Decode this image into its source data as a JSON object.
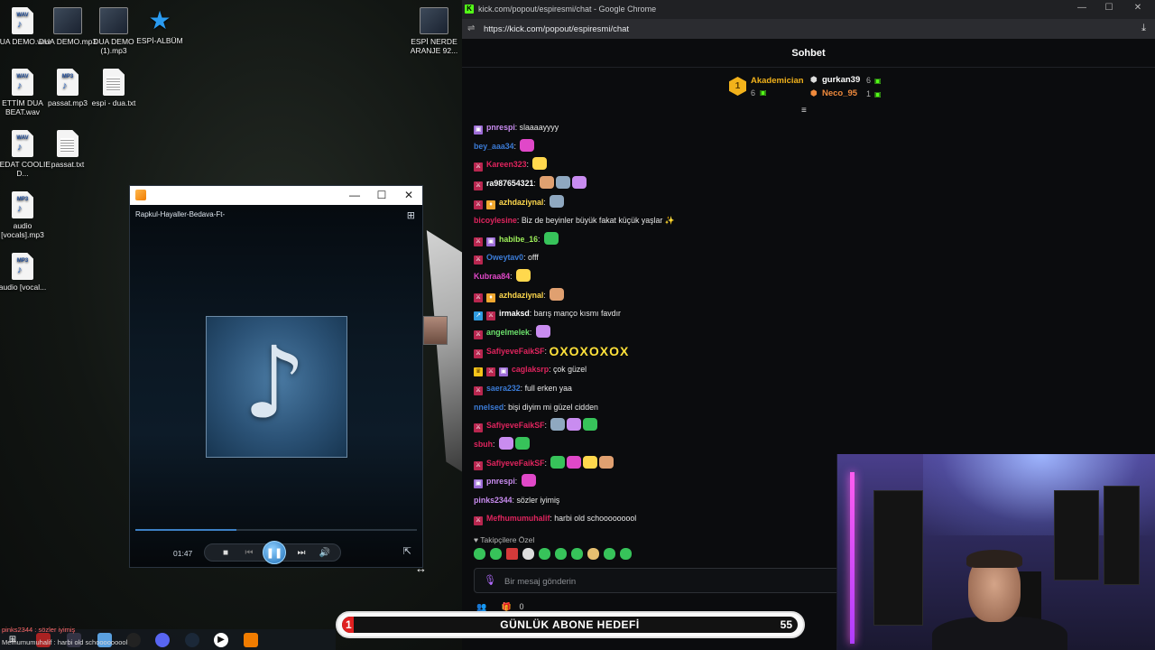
{
  "desktop": {
    "icons": [
      {
        "label": "DUA DEMO.wav",
        "tag": "WAV"
      },
      {
        "label": "DUA DEMO.mp3",
        "tag": ""
      },
      {
        "label": "DUA DEMO (1).mp3",
        "tag": ""
      },
      {
        "label": "ESPİ-ALBÜM",
        "tag": ""
      },
      {
        "label": "ESPİ NERDE ARANJE 92...",
        "tag": ""
      },
      {
        "label": "ETTİM DUA BEAT.wav",
        "tag": "WAV"
      },
      {
        "label": "passat.mp3",
        "tag": "MP3"
      },
      {
        "label": "espi - dua.txt",
        "tag": ""
      },
      {
        "label": "SEDAT COOLIE D...",
        "tag": "WAV"
      },
      {
        "label": "passat.txt",
        "tag": ""
      },
      {
        "label": "audio [vocals].mp3",
        "tag": "MP3"
      },
      {
        "label": "audio [vocal...",
        "tag": "MP3"
      }
    ]
  },
  "player": {
    "track_title": "Rapkul-Hayaller-Bedava-Ft-",
    "current_time": "01:47",
    "progress": 0.36,
    "icons": {
      "app": "media-player-icon",
      "minimize": "minimize-icon",
      "maximize": "maximize-icon",
      "close": "close-icon",
      "miniplayer": "miniplayer-icon",
      "stop": "stop-icon",
      "previous": "previous-icon",
      "pause": "pause-icon",
      "next": "next-icon",
      "volume": "volume-icon",
      "fullscreen": "fullscreen-icon"
    }
  },
  "browser": {
    "window_title": "kick.com/popout/espiresmi/chat - Google Chrome",
    "url": "https://kick.com/popout/espiresmi/chat"
  },
  "chat": {
    "title": "Sohbet",
    "leaderboard": [
      {
        "name": "Akademician",
        "count": "6",
        "rank": "1",
        "color": "#f2b21b"
      },
      {
        "name": "gurkan39",
        "count": "6",
        "color": "#ffffff"
      },
      {
        "name": "Neco_95",
        "count": "1",
        "color": "#f08a3c"
      }
    ],
    "messages": [
      {
        "user": "pnrespi",
        "color": "#c98cf0",
        "badges": [
          "gift"
        ],
        "text": "slaaaayyyy",
        "emotes": 0
      },
      {
        "user": "bey_aaa34",
        "color": "#3b7bd6",
        "badges": [],
        "text": "",
        "emotes": 1
      },
      {
        "user": "Kareen323",
        "color": "#e0245e",
        "badges": [
          "mod"
        ],
        "text": "",
        "emotes": 1
      },
      {
        "user": "ra987654321",
        "color": "#ffffff",
        "badges": [
          "mod"
        ],
        "text": "",
        "emotes": 3
      },
      {
        "user": "azhdaziynal",
        "color": "#ffd84d",
        "badges": [
          "mod",
          "sub"
        ],
        "text": "",
        "emotes": 1
      },
      {
        "user": "bicoylesine",
        "color": "#e0245e",
        "badges": [],
        "text": "Biz de beyinler büyük fakat küçük yaşlar ✨",
        "emotes": 0
      },
      {
        "user": "habibe_16",
        "color": "#9ef05a",
        "badges": [
          "mod",
          "gift"
        ],
        "text": "",
        "emotes": 1
      },
      {
        "user": "Oweytav0",
        "color": "#3b7bd6",
        "badges": [
          "mod"
        ],
        "text": "offf",
        "emotes": 0
      },
      {
        "user": "Kubraa84",
        "color": "#e048c8",
        "badges": [],
        "text": "",
        "emotes": 1
      },
      {
        "user": "azhdaziynal",
        "color": "#ffd84d",
        "badges": [
          "mod",
          "sub"
        ],
        "text": "",
        "emotes": 1
      },
      {
        "user": "irmaksd",
        "color": "#ffffff",
        "badges": [
          "vip",
          "mod"
        ],
        "text": "barış manço kısmı favdır",
        "emotes": 0
      },
      {
        "user": "angelmelek",
        "color": "#6be06b",
        "badges": [
          "mod"
        ],
        "text": "",
        "emotes": 1
      },
      {
        "user": "SafiyeveFaikSF",
        "color": "#e0245e",
        "badges": [
          "mod"
        ],
        "text": "OXOXOXOX",
        "emotes": 0
      },
      {
        "user": "caglaksrp",
        "color": "#e0245e",
        "badges": [
          "crown",
          "mod",
          "gift"
        ],
        "text": "çok güzel",
        "emotes": 0
      },
      {
        "user": "saera232",
        "color": "#3b7bd6",
        "badges": [
          "mod"
        ],
        "text": "full erken yaa",
        "emotes": 0
      },
      {
        "user": "nnelsed",
        "color": "#3b7bd6",
        "badges": [],
        "text": "bişi diyim mi güzel cidden",
        "emotes": 0
      },
      {
        "user": "SafiyeveFaikSF",
        "color": "#e0245e",
        "badges": [
          "mod"
        ],
        "text": "",
        "emotes": 3
      },
      {
        "user": "sbuh",
        "color": "#e0245e",
        "badges": [],
        "text": "",
        "emotes": 2
      },
      {
        "user": "SafiyeveFaikSF",
        "color": "#e0245e",
        "badges": [
          "mod"
        ],
        "text": "",
        "emotes": 4
      },
      {
        "user": "pnrespi",
        "color": "#c98cf0",
        "badges": [
          "gift"
        ],
        "text": "",
        "emotes": 1
      },
      {
        "user": "pinks2344",
        "color": "#c98cf0",
        "badges": [],
        "text": "sözler iyimiş",
        "emotes": 0
      },
      {
        "user": "Mefhumumuhalif",
        "color": "#e0245e",
        "badges": [
          "mod"
        ],
        "text": "harbi old schooooooool",
        "emotes": 0
      }
    ],
    "followers_only": "Takipçilere Özel",
    "input_placeholder": "Bir mesaj gönderin",
    "footer_count": "0"
  },
  "goal": {
    "label": "GÜNLÜK ABONE HEDEFİ",
    "current": "1",
    "target": "55",
    "progress": 0.018
  },
  "overlay": {
    "line1": "pinks2344 : sözler iyimiş",
    "line2": "Mefhumumuhalif : harbi old schooooooool"
  }
}
